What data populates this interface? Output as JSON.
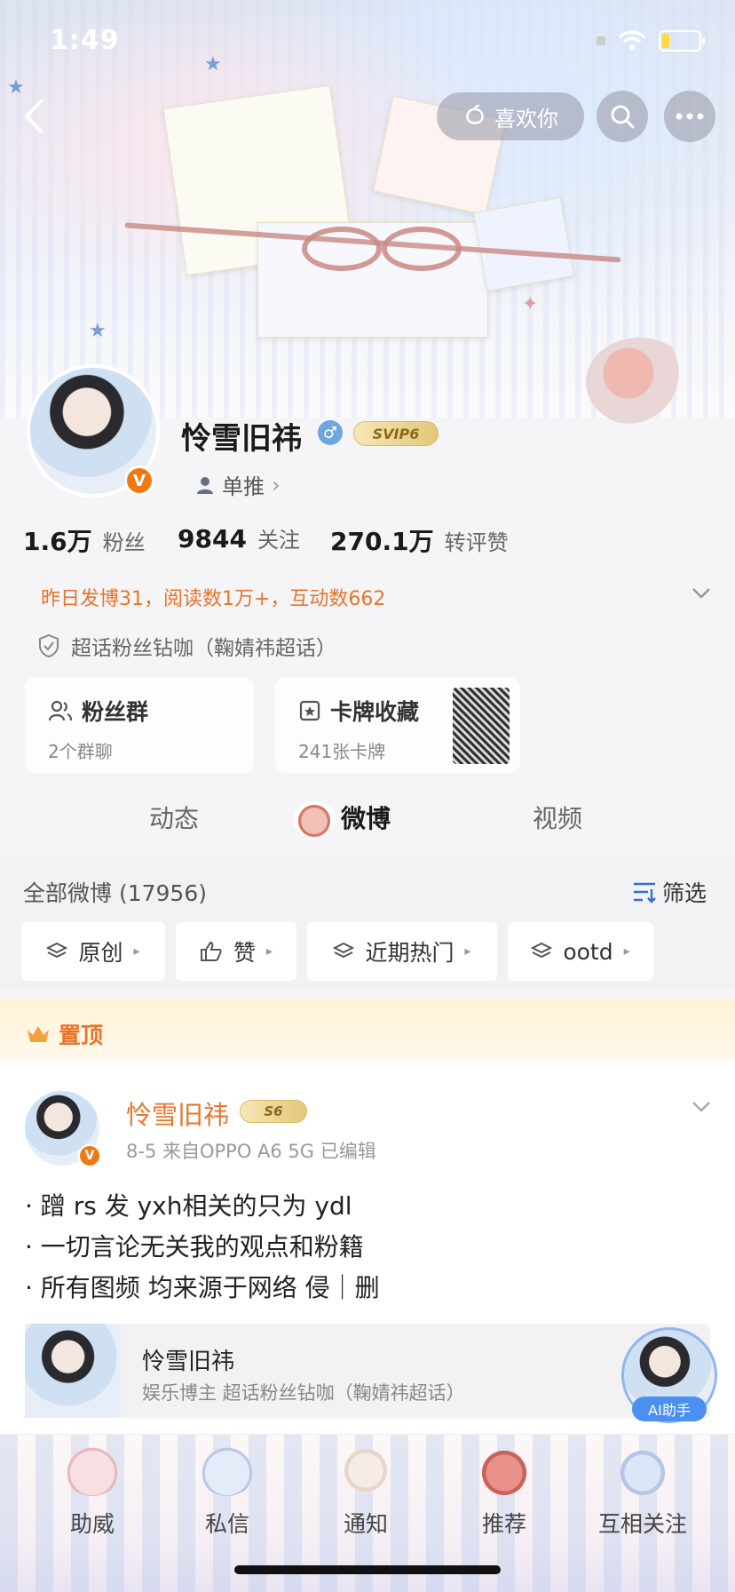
{
  "status_bar": {
    "time": "1:49"
  },
  "top_nav": {
    "like_button_label": "喜欢你"
  },
  "profile": {
    "name": "怜雪旧祎",
    "avatar_badge": "V",
    "gender_symbol": "♂",
    "svip_badge": "SVIP6",
    "stan_label": "单推",
    "stats": [
      {
        "value": "1.6万",
        "label": "粉丝"
      },
      {
        "value": "9844",
        "label": "关注"
      },
      {
        "value": "270.1万",
        "label": "转评赞"
      }
    ],
    "activity": "昨日发博31，阅读数1万+，互动数662",
    "supertopic": "超话粉丝钻咖（鞠婧祎超话）"
  },
  "cards": [
    {
      "title": "粉丝群",
      "subtitle": "2个群聊"
    },
    {
      "title": "卡牌收藏",
      "subtitle": "241张卡牌"
    }
  ],
  "tabs": [
    {
      "label": "动态"
    },
    {
      "label": "微博"
    },
    {
      "label": "视频"
    }
  ],
  "filter": {
    "all_label": "全部微博 (17956)",
    "filter_label": "筛选",
    "chips": [
      "原创",
      "赞",
      "近期热门",
      "ootd"
    ]
  },
  "pinned": {
    "label": "置顶",
    "author": "怜雪旧祎",
    "level": "S6",
    "badge": "V",
    "meta": "8-5  来自OPPO A6 5G  已编辑",
    "lines": [
      "· 蹭 rs 发 yxh相关的只为 ydl",
      "· 一切言论无关我的观点和粉籍",
      "· 所有图频 均来源于网络 侵｜删"
    ]
  },
  "author_card": {
    "name": "怜雪旧祎",
    "desc": "娱乐博主 超话粉丝钻咖（鞠婧祎超话）",
    "ai_label": "AI助手"
  },
  "bottom_bar": [
    {
      "label": "助威"
    },
    {
      "label": "私信"
    },
    {
      "label": "通知"
    },
    {
      "label": "推荐"
    },
    {
      "label": "互相关注"
    }
  ],
  "colors": {
    "accent": "#e8742b",
    "ai_blue": "#4b8ff0",
    "vip_gold": "#e3c77a"
  },
  "icons": [
    "back-icon",
    "peach-icon",
    "search-icon",
    "more-icon",
    "person-icon",
    "chevron-right-icon",
    "shield-icon",
    "group-icon",
    "card-icon",
    "layers-icon",
    "thumbs-up-icon",
    "filter-icon",
    "crown-icon",
    "chevron-down-icon"
  ]
}
